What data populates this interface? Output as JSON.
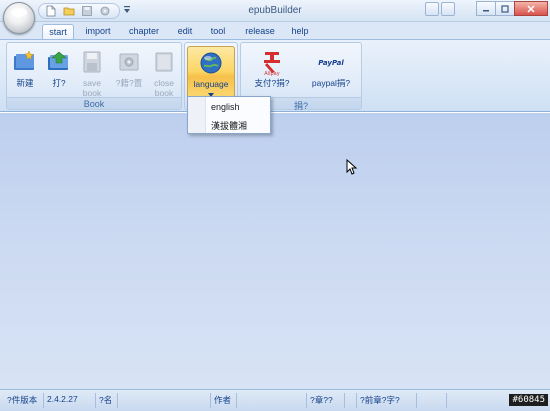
{
  "window": {
    "title": "epubBuilder"
  },
  "tabs": [
    {
      "label": "start",
      "active": true
    },
    {
      "label": "import"
    },
    {
      "label": "chapter"
    },
    {
      "label": "edit"
    },
    {
      "label": "tool"
    },
    {
      "label": "release"
    },
    {
      "label": "help"
    }
  ],
  "ribbon": {
    "book_group": {
      "label": "Book",
      "buttons": [
        {
          "label_line1": "新建",
          "label_line2": "",
          "icon": "new-book-icon",
          "enabled": true
        },
        {
          "label_line1": "打?",
          "label_line2": "",
          "icon": "open-book-icon",
          "enabled": true
        },
        {
          "label_line1": "save",
          "label_line2": "book",
          "icon": "save-icon",
          "enabled": false
        },
        {
          "label_line1": "?籍?置",
          "label_line2": "",
          "icon": "book-settings-icon",
          "enabled": false
        },
        {
          "label_line1": "close",
          "label_line2": "book",
          "icon": "close-book-icon",
          "enabled": false
        }
      ]
    },
    "language_group": {
      "button_label": "language",
      "icon": "globe-icon"
    },
    "donate_group": {
      "label": "捐?",
      "buttons": [
        {
          "label": "支付?捐?",
          "icon": "alipay-icon"
        },
        {
          "label": "paypal捐?",
          "icon": "paypal-icon"
        }
      ]
    }
  },
  "language_menu": {
    "items": [
      "english",
      "漢拔體湘"
    ]
  },
  "statusbar": {
    "cells": [
      "?件版本",
      "2.4.2.27",
      "?名",
      "",
      "作者",
      "",
      "?章??",
      "",
      "?前章?字?",
      ""
    ]
  },
  "watermark": "#60845",
  "colors": {
    "accent": "#15428b",
    "workspace": "#c8d7f0",
    "pressed": "#fcd665"
  }
}
